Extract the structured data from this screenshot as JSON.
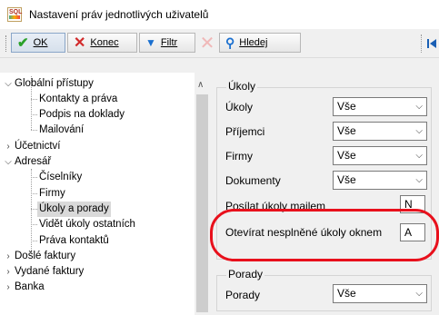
{
  "window": {
    "title": "Nastavení práv jednotlivých uživatelů",
    "icon": "app-logo-icon"
  },
  "toolbar": {
    "ok": {
      "label": "OK",
      "icon": "check-icon"
    },
    "konec": {
      "label": "Konec",
      "icon": "close-icon"
    },
    "filtr": {
      "label": "Filtr",
      "icon": "filter-icon"
    },
    "disabled": {
      "icon": "disabled-close-icon"
    },
    "hledej": {
      "label": "Hledej",
      "icon": "search-icon"
    },
    "first": {
      "icon": "first-record-icon"
    }
  },
  "tree": {
    "items": [
      {
        "label": "Globální přístupy",
        "expanded": true
      },
      {
        "label": "Kontakty a práva"
      },
      {
        "label": "Podpis na doklady"
      },
      {
        "label": "Mailování"
      },
      {
        "label": "Účetnictví",
        "expanded": false
      },
      {
        "label": "Adresář",
        "expanded": true
      },
      {
        "label": "Číselníky"
      },
      {
        "label": "Firmy"
      },
      {
        "label": "Úkoly a porady",
        "selected": true
      },
      {
        "label": "Vidět úkoly ostatních"
      },
      {
        "label": "Práva kontaktů"
      },
      {
        "label": "Došlé faktury",
        "expanded": false
      },
      {
        "label": "Vydané faktury",
        "expanded": false
      },
      {
        "label": "Banka",
        "expanded": false
      }
    ]
  },
  "ukoly": {
    "title": "Úkoly",
    "rows": [
      {
        "label": "Úkoly",
        "value": "Vše"
      },
      {
        "label": "Příjemci",
        "value": "Vše"
      },
      {
        "label": "Firmy",
        "value": "Vše"
      },
      {
        "label": "Dokumenty",
        "value": "Vše"
      }
    ],
    "posilat": {
      "label": "Posílat úkoly mailem",
      "value": "N"
    },
    "otevirat": {
      "label": "Otevírat nesplněné úkoly oknem",
      "value": "A"
    }
  },
  "porady": {
    "title": "Porady",
    "row": {
      "label": "Porady",
      "value": "Vše"
    }
  },
  "colors": {
    "highlight_oval": "#e8101c",
    "accent": "#1a6fcf"
  }
}
